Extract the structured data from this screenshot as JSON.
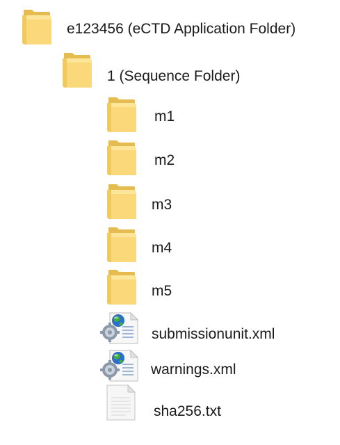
{
  "tree": {
    "root": {
      "label": "e123456 (eCTD Application Folder)",
      "icon": "folder-icon"
    },
    "sequence": {
      "label": "1 (Sequence Folder)",
      "icon": "folder-icon"
    },
    "modules": [
      {
        "label": "m1",
        "icon": "folder-icon"
      },
      {
        "label": "m2",
        "icon": "folder-icon"
      },
      {
        "label": "m3",
        "icon": "folder-icon"
      },
      {
        "label": "m4",
        "icon": "folder-icon"
      },
      {
        "label": "m5",
        "icon": "folder-icon"
      }
    ],
    "files": [
      {
        "label": "submissionunit.xml",
        "icon": "xml-file-icon"
      },
      {
        "label": "warnings.xml",
        "icon": "xml-file-icon"
      },
      {
        "label": "sha256.txt",
        "icon": "text-file-icon"
      }
    ]
  },
  "colors": {
    "folder_back": "#e9c15a",
    "folder_front": "#fbd97a",
    "folder_shade": "#f4cd66",
    "file_paper": "#f6f6f6",
    "file_border": "#c8c8c8",
    "globe_blue": "#2a6fc9",
    "globe_green": "#3fae3a",
    "gear_gray": "#8b98a8",
    "text": "#1a1a1a"
  }
}
